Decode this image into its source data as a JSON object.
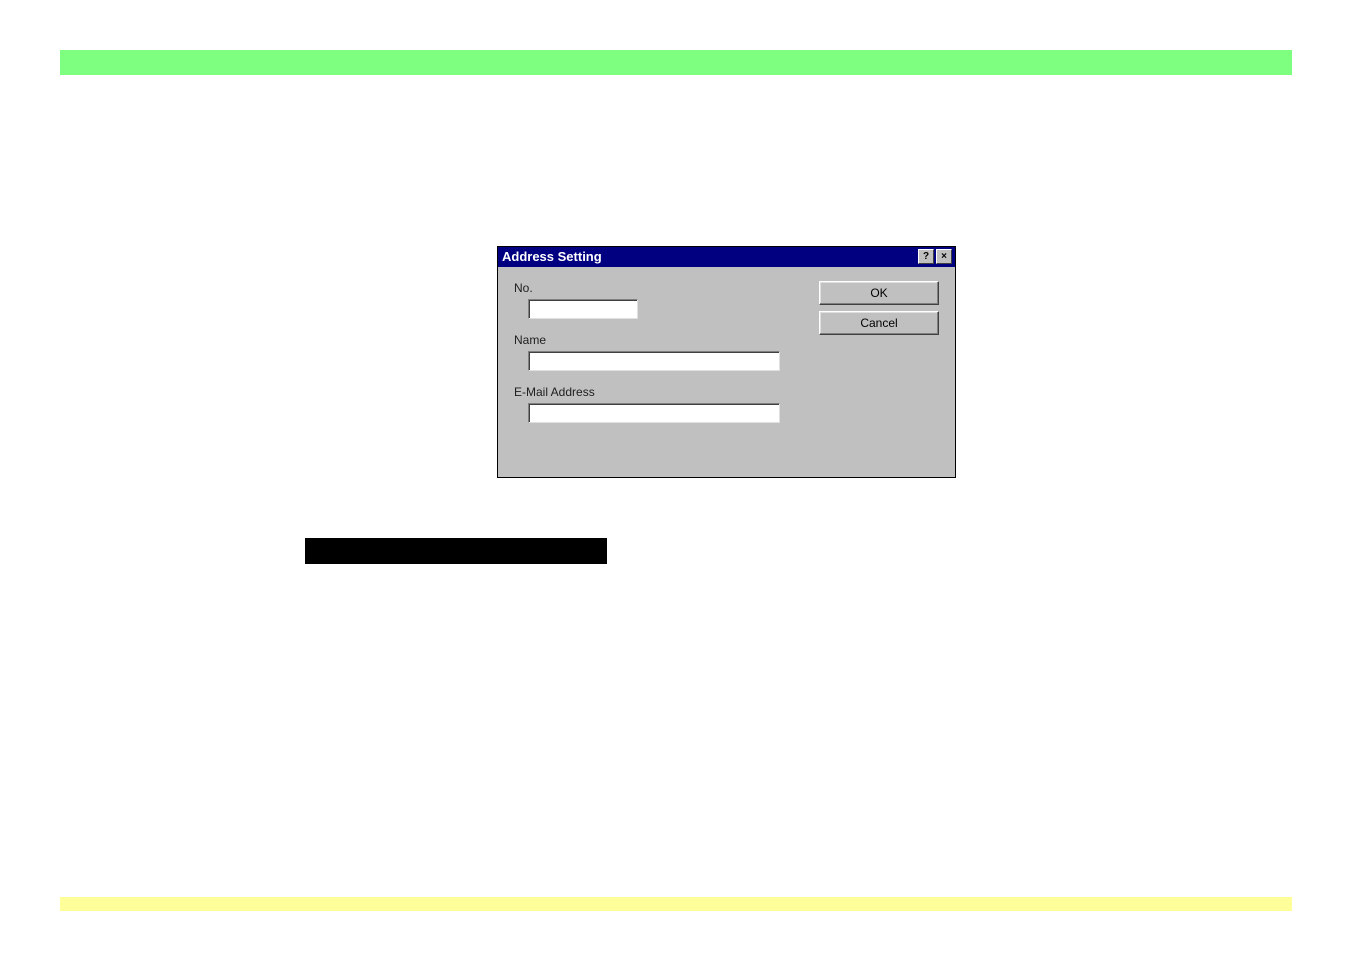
{
  "dialog": {
    "title": "Address Setting",
    "helpGlyph": "?",
    "closeGlyph": "×",
    "fields": {
      "no": {
        "label": "No.",
        "value": ""
      },
      "name": {
        "label": "Name",
        "value": ""
      },
      "email": {
        "label": "E-Mail Address",
        "value": ""
      }
    },
    "buttons": {
      "ok": "OK",
      "cancel": "Cancel"
    }
  }
}
